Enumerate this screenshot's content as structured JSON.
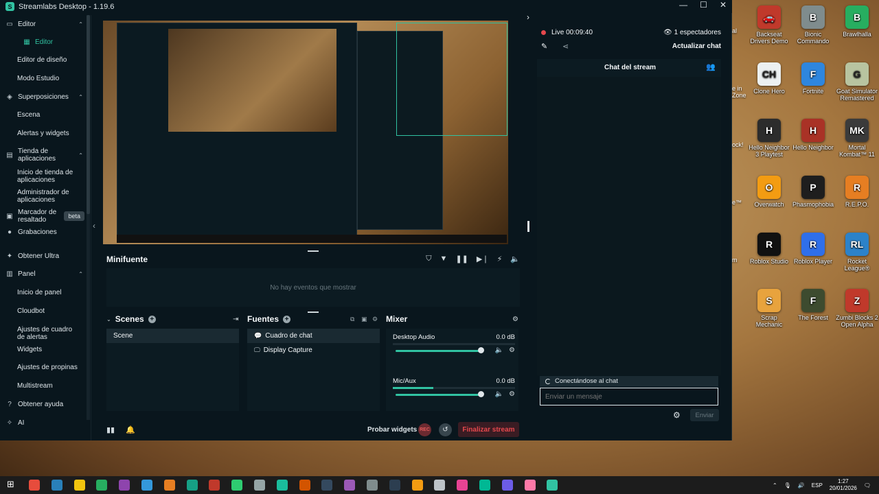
{
  "window": {
    "title": "Streamlabs Desktop - 1.19.6",
    "minimize": "—",
    "maximize": "☐",
    "close": "✕"
  },
  "sidebar": {
    "items": [
      {
        "label": "Editor",
        "icon": "monitor-icon",
        "type": "section",
        "chevron": "⌃"
      },
      {
        "label": "Editor",
        "icon": "grid-icon",
        "type": "sub",
        "active": true
      },
      {
        "label": "Editor de diseño",
        "type": "sub"
      },
      {
        "label": "Modo Estudio",
        "type": "sub"
      },
      {
        "label": "Superposiciones",
        "icon": "layers-icon",
        "type": "section",
        "chevron": "⌃"
      },
      {
        "label": "Escena",
        "type": "sub"
      },
      {
        "label": "Alertas y widgets",
        "type": "sub"
      },
      {
        "label": "Tienda de aplicaciones",
        "icon": "store-icon",
        "type": "section",
        "chevron": "⌃"
      },
      {
        "label": "Inicio de tienda de aplicaciones",
        "type": "sub"
      },
      {
        "label": "Administrador de aplicaciones",
        "type": "sub"
      },
      {
        "label": "Marcador de resaltado",
        "icon": "highlight-icon",
        "type": "section",
        "badge": "beta"
      },
      {
        "label": "Grabaciones",
        "icon": "record-icon",
        "type": "section"
      },
      {
        "label": "Obtener Ultra",
        "icon": "ultra-icon",
        "type": "section"
      },
      {
        "label": "Panel",
        "icon": "panel-icon",
        "type": "section",
        "chevron": "⌃"
      },
      {
        "label": "Inicio de panel",
        "type": "sub"
      },
      {
        "label": "Cloudbot",
        "type": "sub"
      },
      {
        "label": "Ajustes de cuadro de alertas",
        "type": "sub"
      },
      {
        "label": "Widgets",
        "type": "sub"
      },
      {
        "label": "Ajustes de propinas",
        "type": "sub"
      },
      {
        "label": "Multistream",
        "type": "sub"
      },
      {
        "label": "Obtener ayuda",
        "icon": "help-icon",
        "type": "section"
      },
      {
        "label": "AI",
        "icon": "ai-icon",
        "type": "section"
      }
    ]
  },
  "minifeed": {
    "title": "Minifuente",
    "empty": "No hay eventos que mostrar"
  },
  "scenes": {
    "title": "Scenes",
    "items": [
      "Scene"
    ]
  },
  "sources": {
    "title": "Fuentes",
    "items": [
      {
        "label": "Cuadro de chat",
        "icon": "chat-bubble-icon"
      },
      {
        "label": "Display Capture",
        "icon": "display-icon"
      }
    ]
  },
  "mixer": {
    "title": "Mixer",
    "channels": [
      {
        "label": "Desktop Audio",
        "db": "0.0 dB",
        "level": 0
      },
      {
        "label": "Mic/Aux",
        "db": "0.0 dB",
        "level": 0.33
      }
    ]
  },
  "footer": {
    "test_widgets": "Probar widgets",
    "rec": "REC",
    "end_stream": "Finalizar stream"
  },
  "chat": {
    "live": "Live 00:09:40",
    "viewers": "1 espectadores",
    "refresh": "Actualizar chat",
    "header": "Chat del stream",
    "connecting": "Conectándose al chat",
    "placeholder": "Enviar un mensaje",
    "send": "Enviar"
  },
  "desktop_icons": [
    {
      "label": "Backseat Drivers Demo",
      "color": "#c0392b",
      "glyph": "🚗"
    },
    {
      "label": "Bionic Commando",
      "color": "#7f8c8d",
      "glyph": "B"
    },
    {
      "label": "Brawlhalla",
      "color": "#27ae60",
      "glyph": "B"
    },
    {
      "label": "Clone Hero",
      "color": "#ecf0f1",
      "glyph": "CH"
    },
    {
      "label": "Fortnite",
      "color": "#2e86de",
      "glyph": "F"
    },
    {
      "label": "Goat Simulator Remastered",
      "color": "#b8c4a0",
      "glyph": "G"
    },
    {
      "label": "Hello Neighbor 3 Playtest",
      "color": "#2c2c2c",
      "glyph": "H"
    },
    {
      "label": "Hello Neighbor",
      "color": "#a93226",
      "glyph": "H"
    },
    {
      "label": "Mortal Kombat™ 11",
      "color": "#3b3b3b",
      "glyph": "MK"
    },
    {
      "label": "Overwatch",
      "color": "#f39c12",
      "glyph": "O"
    },
    {
      "label": "Phasmophobia",
      "color": "#1e1e1e",
      "glyph": "P"
    },
    {
      "label": "R.E.P.O.",
      "color": "#e67e22",
      "glyph": "R"
    },
    {
      "label": "Roblox Studio",
      "color": "#111111",
      "glyph": "R"
    },
    {
      "label": "Roblox Player",
      "color": "#2f6fea",
      "glyph": "R"
    },
    {
      "label": "Rocket League®",
      "color": "#2c82c9",
      "glyph": "RL"
    },
    {
      "label": "Scrap Mechanic",
      "color": "#e8a33d",
      "glyph": "S"
    },
    {
      "label": "The Forest",
      "color": "#3d4b2f",
      "glyph": "F"
    },
    {
      "label": "Zumbi Blocks 2 Open Alpha",
      "color": "#c0392b",
      "glyph": "Z"
    }
  ],
  "desktop_edge_labels": [
    "al",
    "e in",
    "Zone",
    "ock!",
    "e™",
    "m"
  ],
  "taskbar": {
    "lang": "ESP",
    "time": "1:27",
    "date": "20/01/2026",
    "app_colors": [
      "#e74c3c",
      "#2980b9",
      "#f1c40f",
      "#27ae60",
      "#8e44ad",
      "#3498db",
      "#e67e22",
      "#16a085",
      "#c0392b",
      "#2ecc71",
      "#95a5a6",
      "#1abc9c",
      "#d35400",
      "#34495e",
      "#9b59b6",
      "#7f8c8d",
      "#2c3e50",
      "#f39c12",
      "#bdc3c7",
      "#e84393",
      "#00b894",
      "#6c5ce7",
      "#fd79a8",
      "#31c3a2"
    ]
  }
}
